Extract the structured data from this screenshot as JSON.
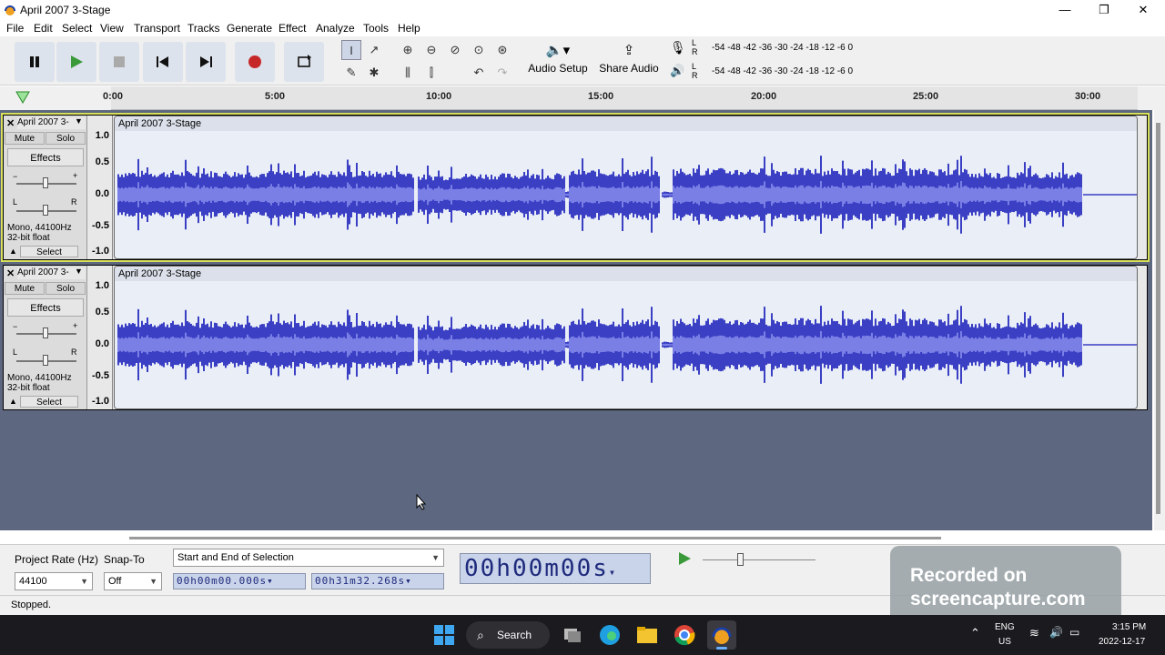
{
  "window": {
    "title": "April 2007 3-Stage",
    "minimize": "—",
    "maximize": "❐",
    "close": "✕"
  },
  "menu": [
    "File",
    "Edit",
    "Select",
    "View",
    "Transport",
    "Tracks",
    "Generate",
    "Effect",
    "Analyze",
    "Tools",
    "Help"
  ],
  "toolbar": {
    "audio_setup": "Audio Setup",
    "share_audio": "Share Audio",
    "record_meter": {
      "l": "L",
      "r": "R",
      "scale": "-54  -48  -42  -36  -30  -24  -18  -12   -6   0"
    },
    "play_meter": {
      "l": "L",
      "r": "R",
      "scale": "-54  -48  -42  -36  -30  -24  -18  -12   -6   0"
    }
  },
  "timeline": {
    "ticks": [
      "0:00",
      "5:00",
      "10:00",
      "15:00",
      "20:00",
      "25:00",
      "30:00"
    ]
  },
  "tracks": [
    {
      "name": "April 2007 3-",
      "clip_name": "April 2007 3-Stage",
      "mute": "Mute",
      "solo": "Solo",
      "effects": "Effects",
      "gain_minus": "−",
      "gain_plus": "+",
      "pan_l": "L",
      "pan_r": "R",
      "info1": "Mono, 44100Hz",
      "info2": "32-bit float",
      "select": "Select",
      "scale": [
        "1.0",
        "0.5",
        "0.0",
        "-0.5",
        "-1.0"
      ],
      "selected": true
    },
    {
      "name": "April 2007 3-",
      "clip_name": "April 2007 3-Stage",
      "mute": "Mute",
      "solo": "Solo",
      "effects": "Effects",
      "gain_minus": "−",
      "gain_plus": "+",
      "pan_l": "L",
      "pan_r": "R",
      "info1": "Mono, 44100Hz",
      "info2": "32-bit float",
      "select": "Select",
      "scale": [
        "1.0",
        "0.5",
        "0.0",
        "-0.5",
        "-1.0"
      ],
      "selected": false
    }
  ],
  "bottom": {
    "project_rate_label": "Project Rate (Hz)",
    "project_rate_value": "44100",
    "snap_label": "Snap-To",
    "snap_value": "Off",
    "selection_mode": "Start and End of Selection",
    "sel_start": "00h00m00.000s",
    "sel_end": "00h31m32.268s",
    "big_time": "00h00m00s"
  },
  "status": "Stopped.",
  "watermark": {
    "line1": "Recorded on",
    "line2": "screencapture.com"
  },
  "taskbar": {
    "search": "Search",
    "lang1": "ENG",
    "lang2": "US",
    "time": "3:15 PM",
    "date": "2022-12-17"
  },
  "colors": {
    "waveform": "#3a3fc4",
    "waveform_rms": "#7a7fe6",
    "track_bg": "#5d6780",
    "time_text": "#1e2a7c",
    "record": "#c62828",
    "play": "#3a9a3a"
  }
}
